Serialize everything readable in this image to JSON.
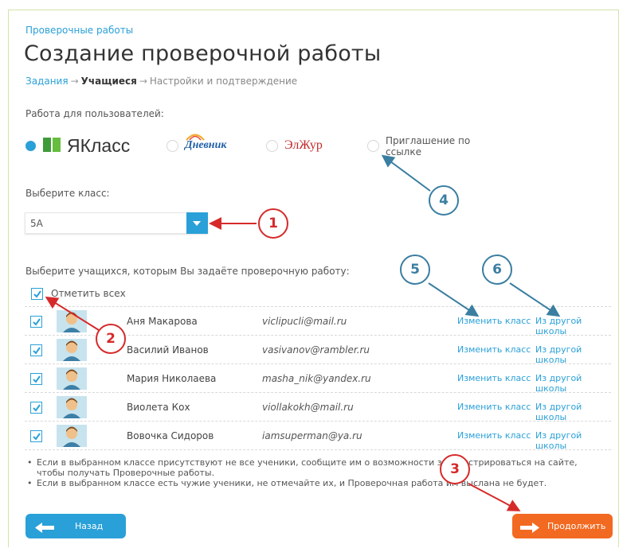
{
  "header": {
    "top_link": "Проверочные работы",
    "title": "Создание проверочной работы",
    "steps": [
      "Задания",
      "Учащиеся",
      "Настройки и подтверждение"
    ]
  },
  "users_section": {
    "label": "Работа для пользователей:",
    "options": [
      {
        "label": "ЯКласс",
        "selected": true
      },
      {
        "label": "Дневник",
        "selected": false
      },
      {
        "label": "ЭлЖур",
        "selected": false
      },
      {
        "label": "Приглашение по ссылке",
        "selected": false
      }
    ]
  },
  "class_section": {
    "label": "Выберите класс:",
    "selected_value": "5А"
  },
  "students_section": {
    "label": "Выберите учащихся, которым Вы задаёте проверочную работу:",
    "select_all_label": "Отметить всех",
    "rows": [
      {
        "name": "Аня Макарова",
        "email": "viclipucli@mail.ru",
        "change_class": "Изменить класс",
        "other_school": "Из другой школы"
      },
      {
        "name": "Василий Иванов",
        "email": "vasivanov@rambler.ru",
        "change_class": "Изменить класс",
        "other_school": "Из другой школы"
      },
      {
        "name": "Мария Николаева",
        "email": "masha_nik@yandex.ru",
        "change_class": "Изменить класс",
        "other_school": "Из другой школы"
      },
      {
        "name": "Виолета Кох",
        "email": "viollakokh@mail.ru",
        "change_class": "Изменить класс",
        "other_school": "Из другой школы"
      },
      {
        "name": "Вовочка Сидоров",
        "email": "iamsuperman@ya.ru",
        "change_class": "Изменить класс",
        "other_school": "Из другой школы"
      }
    ]
  },
  "notes": [
    "Если в выбранном классе присутствуют не все ученики, сообщите им о возможности зарегистрироваться на сайте, чтобы получать Проверочные работы.",
    "Если в выбранном классе есть чужие ученики, не отмечайте их, и Проверочная работа им выслана не будет."
  ],
  "buttons": {
    "back": "Назад",
    "next": "Продолжить"
  },
  "callouts": [
    "1",
    "2",
    "3",
    "4",
    "5",
    "6"
  ],
  "colors": {
    "accent": "#2aa0d8",
    "primary_action": "#f26a21",
    "annotation_red": "#d62a2a",
    "annotation_blue": "#3a7ea1"
  }
}
